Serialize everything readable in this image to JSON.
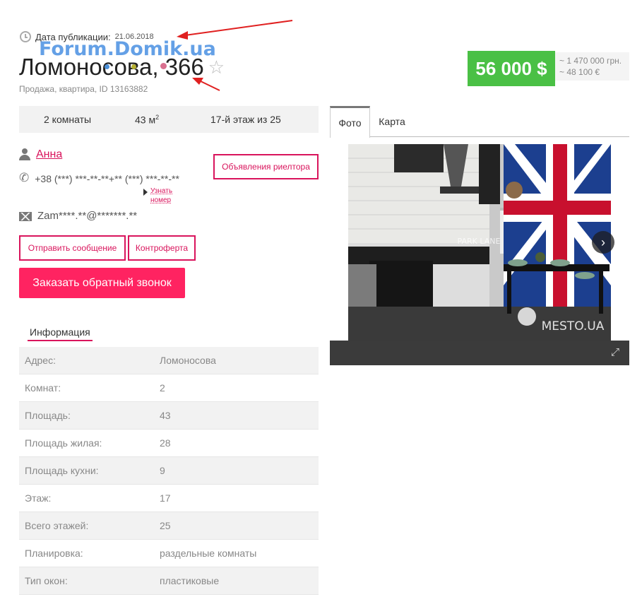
{
  "publication": {
    "label": "Дата публикации:",
    "date": "21.06.2018"
  },
  "watermark": "Forum.Domik.ua",
  "listing": {
    "title": "Ломоносова, 366",
    "subtitle": "Продажа, квартира, ID 13163882"
  },
  "price": {
    "main": "56 000 $",
    "uah": "~ 1 470 000 грн.",
    "eur": "~ 48 100 €"
  },
  "specs": {
    "rooms": "2 комнаты",
    "area": "43 м",
    "area_sup": "2",
    "floor": "17-й этаж из 25"
  },
  "contact": {
    "name": "Анна",
    "phone": "+38 (***) ***-**-**+** (***) ***-**-**",
    "know_number": "Узнать номер",
    "email": "Zam****.**@*******.**"
  },
  "buttons": {
    "realtor_ads": "Объявления риелтора",
    "send_message": "Отправить сообщение",
    "counteroffer": "Контроферта",
    "callback": "Заказать обратный звонок"
  },
  "info": {
    "tab_label": "Информация",
    "rows": [
      {
        "key": "Адрес:",
        "value": "Ломоносова"
      },
      {
        "key": "Комнат:",
        "value": "2"
      },
      {
        "key": "Площадь:",
        "value": "43"
      },
      {
        "key": "Площадь жилая:",
        "value": "28"
      },
      {
        "key": "Площадь кухни:",
        "value": "9"
      },
      {
        "key": "Этаж:",
        "value": "17"
      },
      {
        "key": "Всего этажей:",
        "value": "25"
      },
      {
        "key": "Планировка:",
        "value": "раздельные комнаты"
      },
      {
        "key": "Тип окон:",
        "value": "пластиковые"
      }
    ]
  },
  "media_tabs": {
    "photo": "Фото",
    "map": "Карта"
  },
  "photo": {
    "watermark_center": "PARK LANE",
    "watermark_brand": "MESTO.UA"
  }
}
